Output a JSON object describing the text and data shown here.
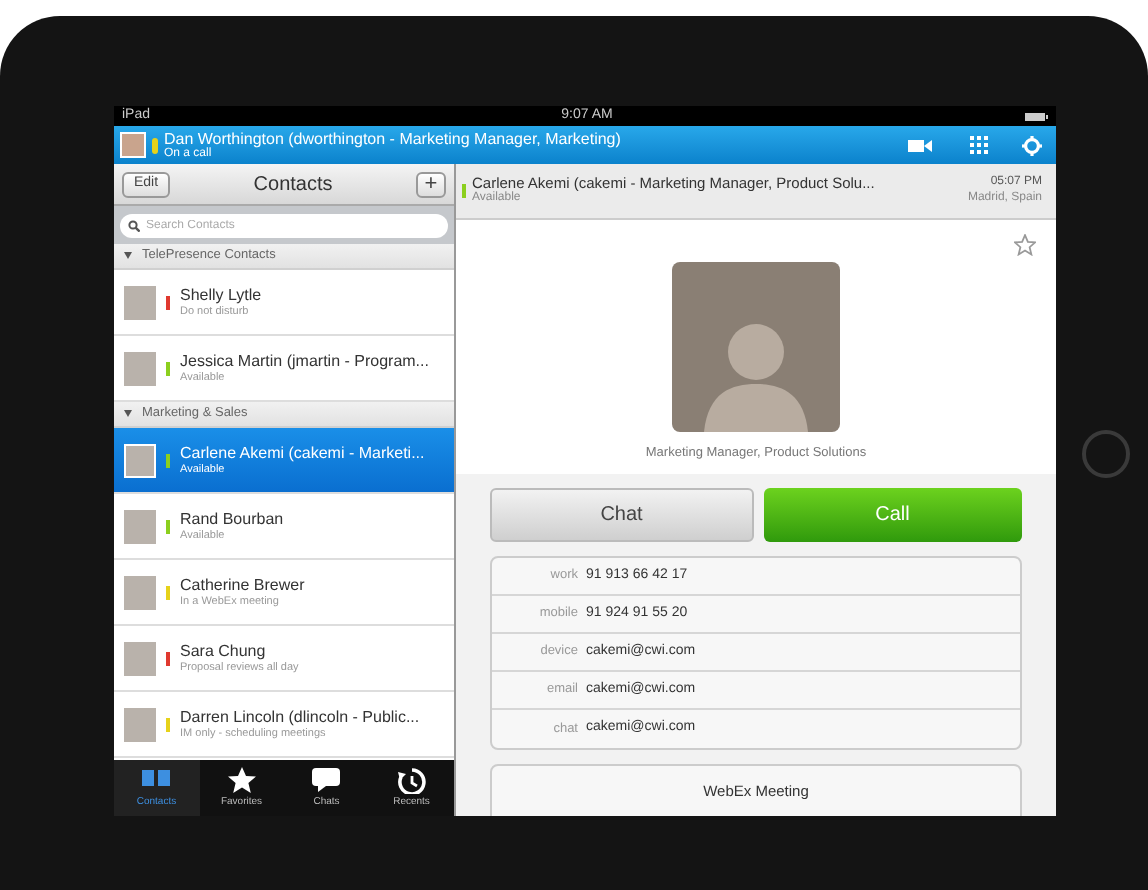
{
  "status_bar": {
    "carrier": "iPad",
    "time": "9:07 AM"
  },
  "header": {
    "name": "Dan Worthington (dworthington - Marketing Manager, Marketing)",
    "status": "On a call",
    "color": "#e6d21a"
  },
  "contacts_pane": {
    "edit": "Edit",
    "title": "Contacts",
    "add": "+",
    "search": {
      "placeholder": "Search Contacts"
    },
    "groups": [
      {
        "title": "TelePresence Contacts",
        "expanded": true,
        "contacts": [
          {
            "name": "Shelly Lytle",
            "status": "Do not disturb",
            "color": "#e0392f",
            "selected": false
          },
          {
            "name": "Jessica Martin (jmartin - Program...",
            "status": "Available",
            "color": "#8ccf1e",
            "selected": false
          }
        ]
      },
      {
        "title": "Marketing & Sales",
        "expanded": true,
        "contacts": [
          {
            "name": "Carlene Akemi (cakemi - Marketi...",
            "status": "Available",
            "color": "#8ccf1e",
            "selected": true
          },
          {
            "name": "Rand Bourban",
            "status": "Available",
            "color": "#8ccf1e",
            "selected": false
          },
          {
            "name": "Catherine Brewer",
            "status": "In a WebEx meeting",
            "color": "#e6d21a",
            "selected": false
          },
          {
            "name": "Sara Chung",
            "status": "Proposal reviews all day",
            "color": "#e0392f",
            "selected": false
          },
          {
            "name": "Darren Lincoln (dlincoln - Public...",
            "status": "IM only - scheduling meetings",
            "color": "#e6d21a",
            "selected": false
          }
        ]
      }
    ]
  },
  "tabs": [
    {
      "label": "Contacts",
      "kind": "book",
      "selected": true
    },
    {
      "label": "Favorites",
      "kind": "star",
      "selected": false
    },
    {
      "label": "Chats",
      "kind": "bubble",
      "selected": false
    },
    {
      "label": "Recents",
      "kind": "clock",
      "selected": false
    }
  ],
  "detail": {
    "name": "Carlene Akemi (cakemi - Marketing Manager, Product Solu...",
    "status": "Available",
    "color": "#8ccf1e",
    "time": "05:07 PM",
    "location": "Madrid, Spain",
    "favorite": false,
    "job_title": "Marketing Manager, Product Solutions",
    "chat_button": "Chat",
    "call_button": "Call",
    "fields": [
      {
        "label": "work",
        "value": "91 913 66 42 17"
      },
      {
        "label": "mobile",
        "value": "91 924 91 55 20"
      },
      {
        "label": "device",
        "value": "cakemi@cwi.com"
      },
      {
        "label": "email",
        "value": "cakemi@cwi.com"
      },
      {
        "label": "chat",
        "value": "cakemi@cwi.com"
      }
    ],
    "webex": "WebEx Meeting"
  }
}
